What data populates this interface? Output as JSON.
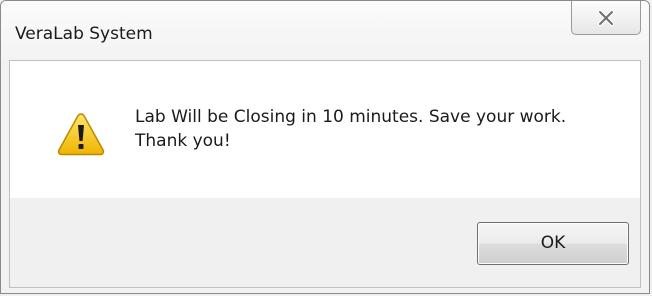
{
  "window": {
    "title": "VeraLab System"
  },
  "titlebar": {
    "close_icon": "close-icon"
  },
  "dialog": {
    "icon": "warning-icon",
    "message_line1": "Lab Will be Closing in 10 minutes. Save your work.",
    "message_line2": "Thank you!"
  },
  "buttons": {
    "ok_label": "OK"
  },
  "colors": {
    "warning_yellow": "#f5c400",
    "content_background": "#ffffff",
    "footer_background": "#f0f0f0"
  }
}
